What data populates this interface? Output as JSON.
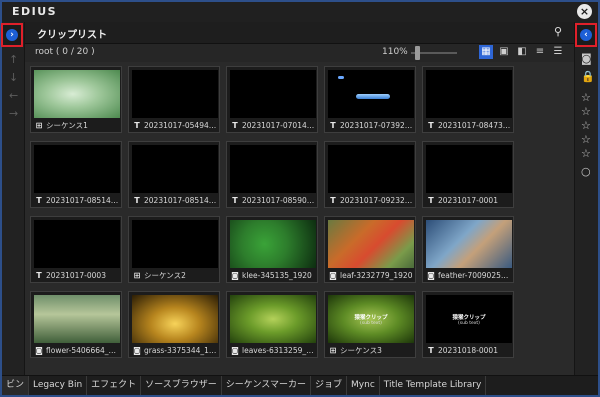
{
  "app": {
    "title": "EDIUS"
  },
  "panel": {
    "title": "クリップリスト",
    "root_label": "root ( 0 / 20 )",
    "zoom": "110%",
    "zoom_level": 0.1
  },
  "clips": [
    {
      "label": "シーケンス1",
      "icon": "sequence",
      "thumb": "green-glow"
    },
    {
      "label": "20231017-05494…",
      "icon": "T",
      "thumb": "black"
    },
    {
      "label": "20231017-07014…",
      "icon": "T",
      "thumb": "black"
    },
    {
      "label": "20231017-07392…",
      "icon": "T",
      "thumb": "blue-bar"
    },
    {
      "label": "20231017-08473…",
      "icon": "T",
      "thumb": "black"
    },
    {
      "label": "20231017-08514…",
      "icon": "T",
      "thumb": "black"
    },
    {
      "label": "20231017-08514…",
      "icon": "T",
      "thumb": "black"
    },
    {
      "label": "20231017-08590…",
      "icon": "T",
      "thumb": "black"
    },
    {
      "label": "20231017-09232…",
      "icon": "T",
      "thumb": "black"
    },
    {
      "label": "20231017-0001",
      "icon": "T",
      "thumb": "black"
    },
    {
      "label": "20231017-0003",
      "icon": "T",
      "thumb": "black"
    },
    {
      "label": "シーケンス2",
      "icon": "sequence",
      "thumb": "black"
    },
    {
      "label": "klee-345135_1920",
      "icon": "camera",
      "thumb": "clover"
    },
    {
      "label": "leaf-3232779_1920",
      "icon": "camera",
      "thumb": "hearts"
    },
    {
      "label": "feather-7009025_…",
      "icon": "camera",
      "thumb": "feather"
    },
    {
      "label": "flower-5406664_1…",
      "icon": "camera",
      "thumb": "flowers"
    },
    {
      "label": "grass-3375344_19…",
      "icon": "camera",
      "thumb": "grass"
    },
    {
      "label": "leaves-6313259_1…",
      "icon": "camera",
      "thumb": "leaves"
    },
    {
      "label": "シーケンス3",
      "icon": "sequence",
      "thumb": "leaves-text"
    },
    {
      "label": "20231018-0001",
      "icon": "T",
      "thumb": "text"
    }
  ],
  "thumb_text": {
    "title": "猿猴クリップ",
    "sub": "(sub text)"
  },
  "tabs": [
    "ビン",
    "Legacy Bin",
    "エフェクト",
    "ソースブラウザー",
    "シーケンスマーカー",
    "ジョブ",
    "Mync",
    "Title Template Library"
  ],
  "colors": {
    "highlight": "#e0202a",
    "accent": "#2e66d6",
    "frame": "#2d4f8a"
  }
}
